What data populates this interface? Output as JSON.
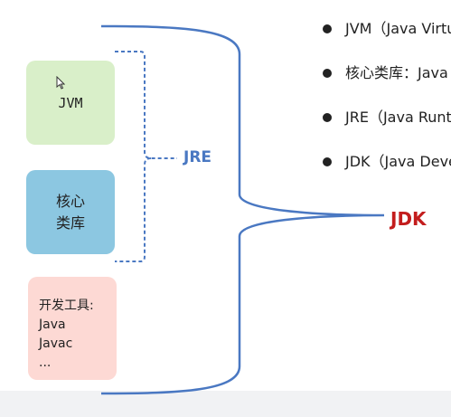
{
  "boxes": {
    "jvm": "JVM",
    "core_library": [
      "核心",
      "类库"
    ],
    "dev_tools": [
      "开发工具:",
      "Java",
      "Javac",
      "..."
    ]
  },
  "labels": {
    "jre": "JRE",
    "jdk": "JDK"
  },
  "bullets": [
    "JVM（Java Virtual Machine）",
    "核心类库：Java Runtime Library",
    "JRE（Java Runtime Environment）",
    "JDK（Java Development Kit）"
  ],
  "colors": {
    "jvm_box": "#d9efc9",
    "core_box": "#8cc7e1",
    "tools_box": "#fdd9d4",
    "jre_label": "#4a78c2",
    "jdk_label": "#c31d1d",
    "brace": "#4a78c2"
  }
}
